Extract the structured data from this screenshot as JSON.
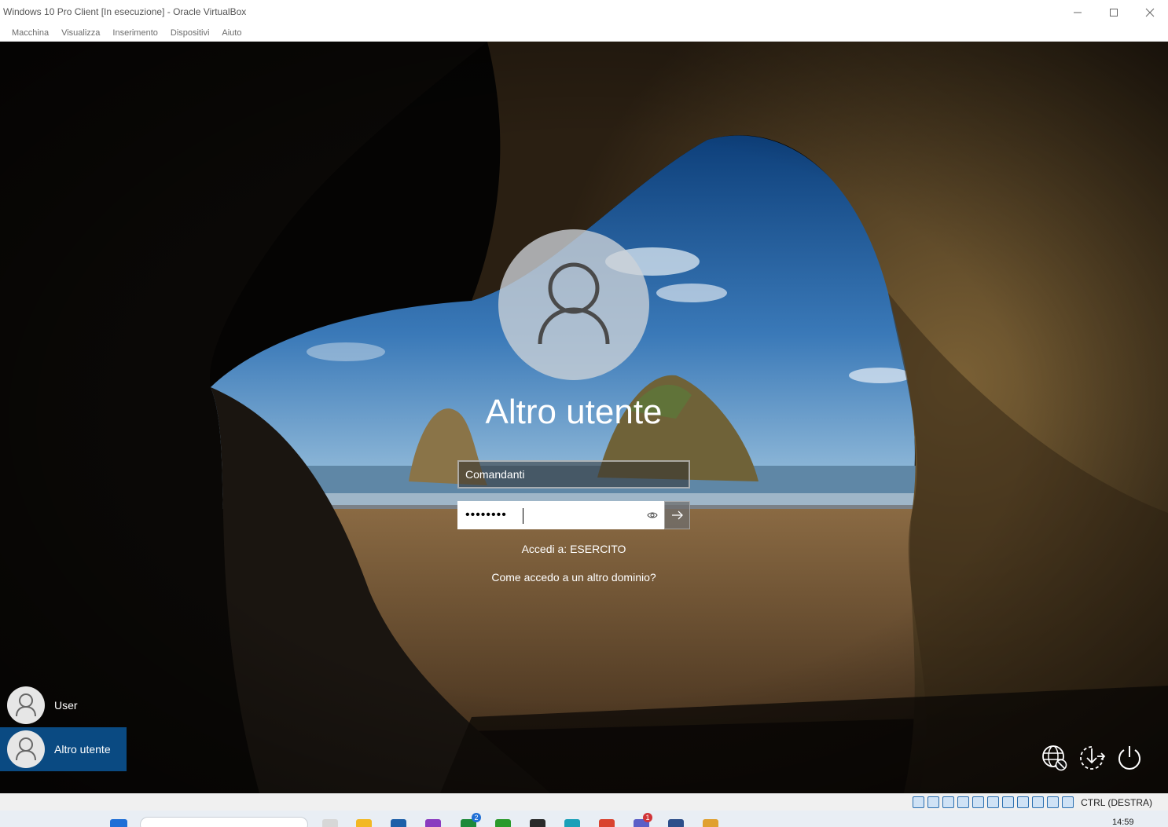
{
  "window": {
    "title": "Windows 10 Pro Client [In esecuzione] - Oracle VirtualBox",
    "controls": [
      "minimize-icon",
      "maximize-icon",
      "close-icon"
    ]
  },
  "menu": {
    "items": [
      "Macchina",
      "Visualizza",
      "Inserimento",
      "Dispositivi",
      "Aiuto"
    ]
  },
  "login": {
    "user_title": "Altro utente",
    "username_value": "Comandanti",
    "password_mask": "••••••••",
    "sign_in_to": "Accedi a: ESERCITO",
    "other_domain_link": "Come accedo a un altro dominio?"
  },
  "user_tiles": [
    {
      "label": "User",
      "selected": false
    },
    {
      "label": "Altro utente",
      "selected": true
    }
  ],
  "corner_icons": [
    "network-icon",
    "accessibility-icon",
    "power-icon"
  ],
  "statusbar": {
    "host_key": "CTRL (DESTRA)"
  },
  "taskbar": {
    "badges": [
      "2",
      "1"
    ],
    "time": "14:59"
  },
  "colors": {
    "selected_tile": "#0a4a82",
    "submit_button": "#6e6e6e",
    "vbox_blue": "#2a6fb0"
  }
}
